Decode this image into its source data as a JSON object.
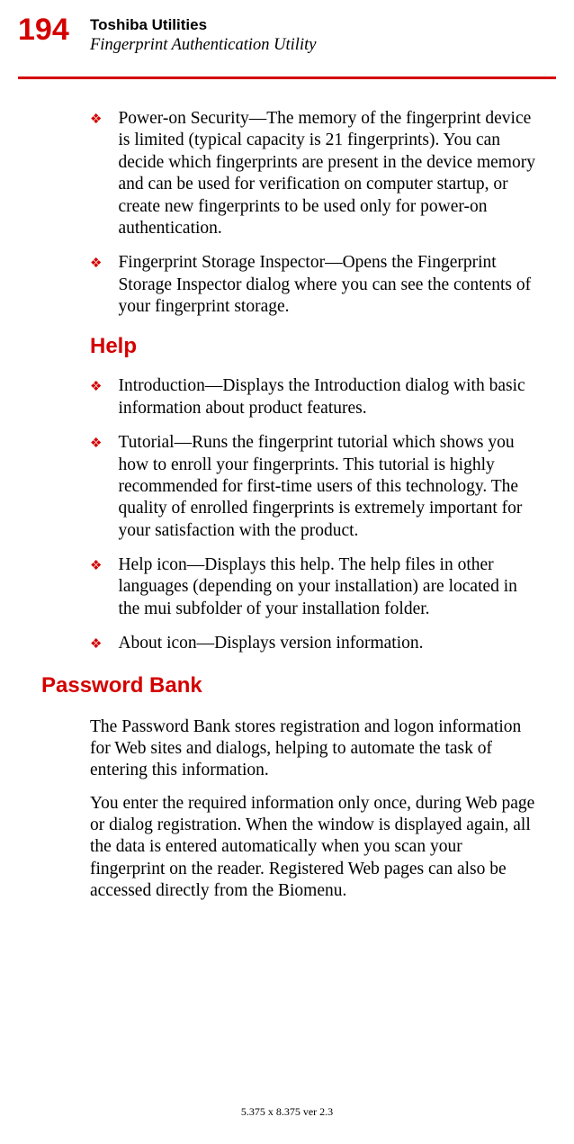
{
  "page_number": "194",
  "header": {
    "title": "Toshiba Utilities",
    "subtitle": "Fingerprint Authentication Utility"
  },
  "bullets_top": [
    "Power-on Security—The memory of the fingerprint device is limited (typical capacity is 21 fingerprints). You can decide which fingerprints are present in the device memory and can be used for verification on computer startup, or create new fingerprints to be used only for power-on authentication.",
    "Fingerprint Storage Inspector—Opens the Fingerprint Storage Inspector dialog where you can see the contents of your fingerprint storage."
  ],
  "help_heading": "Help",
  "bullets_help": [
    "Introduction—Displays the Introduction dialog with basic information about product features.",
    "Tutorial—Runs the fingerprint tutorial which shows you how to enroll your fingerprints. This tutorial is highly recommended for first-time users of this technology. The quality of enrolled fingerprints is extremely important for your satisfaction with the product.",
    "Help icon—Displays this help. The help files in other languages (depending on your installation) are located in the mui subfolder of your installation folder.",
    "About icon—Displays version information."
  ],
  "password_heading": "Password Bank",
  "password_paragraphs": [
    "The Password Bank stores registration and logon information for Web sites and dialogs, helping to automate the task of entering this information.",
    "You enter the required information only once, during Web page or dialog registration. When the window is displayed again, all the data is entered automatically when you scan your fingerprint on the reader. Registered Web pages can also be accessed directly from the Biomenu."
  ],
  "footer": "5.375 x 8.375 ver 2.3"
}
